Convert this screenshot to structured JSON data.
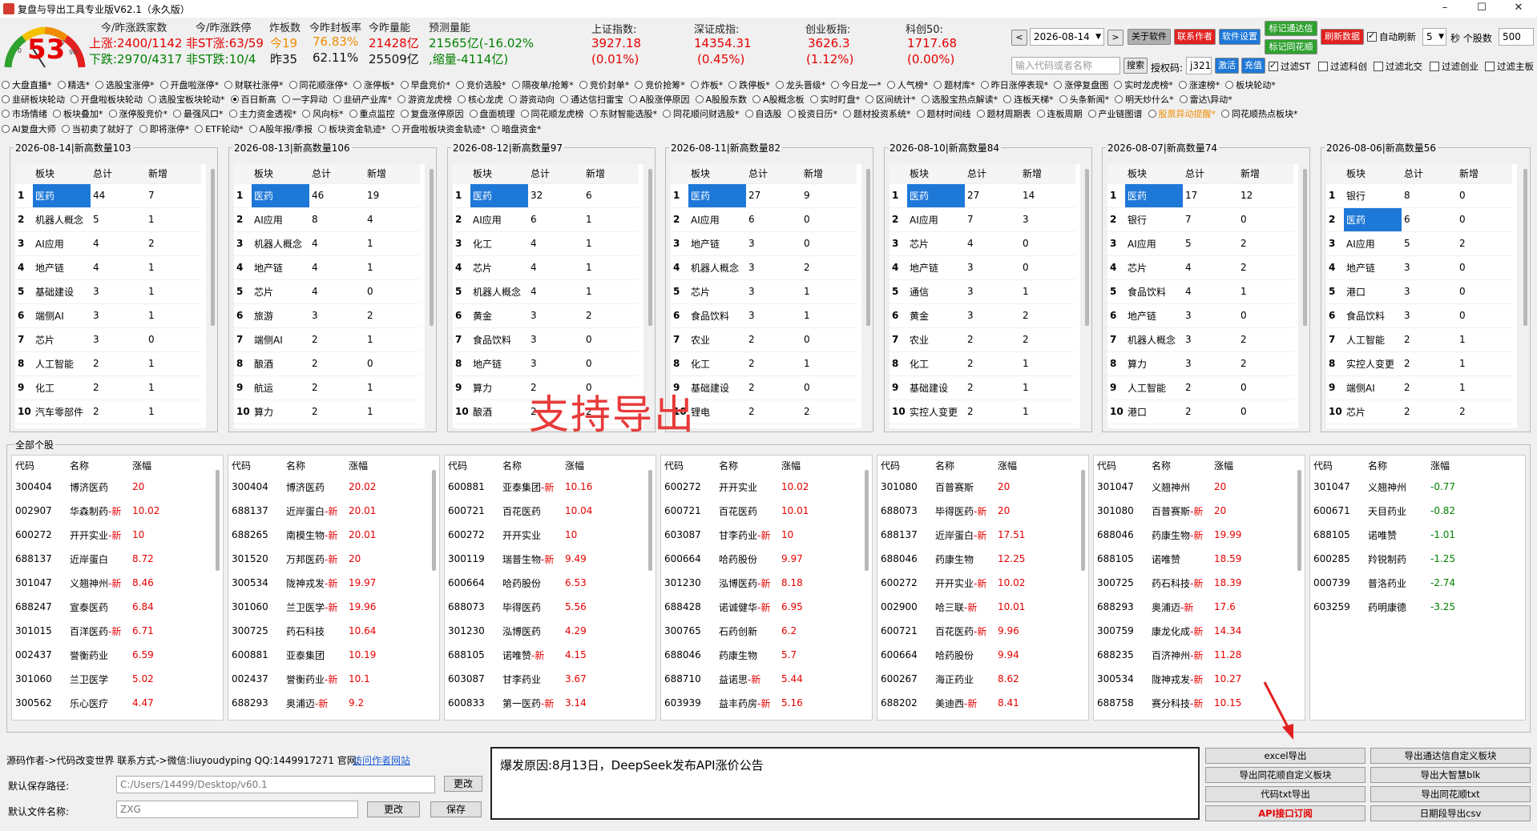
{
  "window": {
    "title": "复盘与导出工具专业版V62.1（永久版）",
    "min": "–",
    "max": "☐",
    "close": "✕"
  },
  "gauge": {
    "value": "53",
    "tick_low": "0",
    "tick_high": "90",
    "tick_mid": "70"
  },
  "header": {
    "col1_title": "今/昨涨跌家数",
    "up_line": "上涨:2400/1142",
    "down_line": "下跌:2970/4317",
    "col2_title": "今/昨涨跌停",
    "limit_up": "非ST涨:63/59",
    "limit_down": "非ST跌:10/4",
    "col3_title": "炸板数",
    "broken_today": "今19",
    "broken_yday": "昨35",
    "col4_title": "今昨封板率",
    "seal_today": "76.83%",
    "seal_yday": "62.11%",
    "col5_title": "今昨量能",
    "vol_today": "21428亿",
    "vol_yday": "25509亿",
    "col6_title": "预测量能",
    "pred_vol": "21565亿(-16.02%",
    "pred_shrink": ",缩量-4114亿)"
  },
  "indices": [
    {
      "name": "上证指数:",
      "value": "3927.18",
      "pct": "(0.01%)"
    },
    {
      "name": "深证成指:",
      "value": "14354.31",
      "pct": "(0.45%)"
    },
    {
      "name": "创业板指:",
      "value": "3626.3",
      "pct": "(1.12%)"
    },
    {
      "name": "科创50:",
      "value": "1717.68",
      "pct": "(0.00%)"
    }
  ],
  "controls": {
    "prev": "<",
    "date": "2026-08-14",
    "next": ">",
    "about": "关于软件",
    "contact": "联系作者",
    "settings": "软件设置",
    "mark_tdx": "标记通达信",
    "mark_ths": "标记同花顺",
    "refresh_data": "刷新数据",
    "auto_refresh": "自动刷新",
    "refresh_interval": "5",
    "sec_label": "秒 个股数",
    "stock_count": "500",
    "search_placeholder": "输入代码或者名称",
    "search": "搜索",
    "auth_label": "授权码:",
    "auth_code": "j321",
    "activate": "激活",
    "recharge": "充值",
    "filter_st": "过滤ST",
    "filter_kc": "过滤科创",
    "filter_bj": "过滤北交",
    "filter_cy": "过滤创业",
    "filter_main": "过滤主板"
  },
  "radio_rows": [
    [
      "大盘直播*",
      "精选*",
      "选股宝涨停*",
      "开盘啦涨停*",
      "财联社涨停*",
      "同花顺涨停*",
      "涨停板*",
      "早盘竞价*",
      "竞价选股*",
      "隔夜单/抢筹*",
      "竞价封单*",
      "竞价抢筹*",
      "炸板*",
      "跌停板*",
      "龙头晋级*",
      "今日龙一*",
      "人气榜*",
      "题材库*",
      "昨日涨停表现*",
      "涨停复盘图",
      "实时龙虎榜*",
      "涨速榜*",
      "板块轮动*"
    ],
    [
      "韭研板块轮动",
      "开盘啦板块轮动",
      "选股宝板块轮动*",
      "百日新高",
      "一字异动",
      "韭研产业库*",
      "游资龙虎榜",
      "核心龙虎",
      "游资动向",
      "通达信扫雷宝",
      "A股涨停原因",
      "A股股东数",
      "A股概念板",
      "实时盯盘*",
      "区间统计*",
      "选股宝热点解读*",
      "连板天梯*",
      "头条新闻*",
      "明天炒什么*",
      "雷达\\异动*"
    ],
    [
      "市场情绪",
      "板块叠加*",
      "涨停股竞价*",
      "最强风口*",
      "主力资金透视*",
      "风向标*",
      "重点监控",
      "复盘涨停原因",
      "盘面梳理",
      "同花顺龙虎榜",
      "东财智能选股*",
      "同花顺问财选股*",
      "自选股",
      "投资日历*",
      "题材投资系统*",
      "题材时间线",
      "题材周期表",
      "连板周期",
      "产业链图谱",
      "股票异动提醒*",
      "同花顺热点板块*"
    ],
    [
      "AI复盘大师",
      "当初卖了就好了",
      "即将涨停*",
      "ETF轮动*",
      "A股年报/季报",
      "板块资金轨迹*",
      "开盘啦板块资金轨迹*",
      "暗盘资金*"
    ]
  ],
  "radio_selected": "百日新高",
  "radio_highlight": "股票异动提醒*",
  "sector_header": {
    "idx": "",
    "name": "板块",
    "total": "总计",
    "new": "新增"
  },
  "sectors": [
    {
      "date": "2026-08-14|新高数量103",
      "rows": [
        [
          "1",
          "医药",
          "44",
          "7"
        ],
        [
          "2",
          "机器人概念",
          "5",
          "1"
        ],
        [
          "3",
          "AI应用",
          "4",
          "2"
        ],
        [
          "4",
          "地产链",
          "4",
          "1"
        ],
        [
          "5",
          "基础建设",
          "3",
          "1"
        ],
        [
          "6",
          "端侧AI",
          "3",
          "1"
        ],
        [
          "7",
          "芯片",
          "3",
          "0"
        ],
        [
          "8",
          "人工智能",
          "2",
          "1"
        ],
        [
          "9",
          "化工",
          "2",
          "1"
        ],
        [
          "10",
          "汽车零部件",
          "2",
          "1"
        ]
      ]
    },
    {
      "date": "2026-08-13|新高数量106",
      "rows": [
        [
          "1",
          "医药",
          "46",
          "19"
        ],
        [
          "2",
          "AI应用",
          "8",
          "4"
        ],
        [
          "3",
          "机器人概念",
          "4",
          "1"
        ],
        [
          "4",
          "地产链",
          "4",
          "1"
        ],
        [
          "5",
          "芯片",
          "4",
          "0"
        ],
        [
          "6",
          "旅游",
          "3",
          "2"
        ],
        [
          "7",
          "端侧AI",
          "2",
          "1"
        ],
        [
          "8",
          "酿酒",
          "2",
          "0"
        ],
        [
          "9",
          "航运",
          "2",
          "1"
        ],
        [
          "10",
          "算力",
          "2",
          "1"
        ]
      ]
    },
    {
      "date": "2026-08-12|新高数量97",
      "rows": [
        [
          "1",
          "医药",
          "32",
          "6"
        ],
        [
          "2",
          "AI应用",
          "6",
          "1"
        ],
        [
          "3",
          "化工",
          "4",
          "1"
        ],
        [
          "4",
          "芯片",
          "4",
          "1"
        ],
        [
          "5",
          "机器人概念",
          "4",
          "1"
        ],
        [
          "6",
          "黄金",
          "3",
          "2"
        ],
        [
          "7",
          "食品饮料",
          "3",
          "0"
        ],
        [
          "8",
          "地产链",
          "3",
          "0"
        ],
        [
          "9",
          "算力",
          "2",
          "0"
        ],
        [
          "10",
          "酿酒",
          "2",
          "2"
        ]
      ]
    },
    {
      "date": "2026-08-11|新高数量82",
      "rows": [
        [
          "1",
          "医药",
          "27",
          "9"
        ],
        [
          "2",
          "AI应用",
          "6",
          "0"
        ],
        [
          "3",
          "地产链",
          "3",
          "0"
        ],
        [
          "4",
          "机器人概念",
          "3",
          "2"
        ],
        [
          "5",
          "芯片",
          "3",
          "1"
        ],
        [
          "6",
          "食品饮料",
          "3",
          "1"
        ],
        [
          "7",
          "农业",
          "2",
          "0"
        ],
        [
          "8",
          "化工",
          "2",
          "1"
        ],
        [
          "9",
          "基础建设",
          "2",
          "0"
        ],
        [
          "10",
          "锂电",
          "2",
          "2"
        ]
      ]
    },
    {
      "date": "2026-08-10|新高数量84",
      "rows": [
        [
          "1",
          "医药",
          "27",
          "14"
        ],
        [
          "2",
          "AI应用",
          "7",
          "3"
        ],
        [
          "3",
          "芯片",
          "4",
          "0"
        ],
        [
          "4",
          "地产链",
          "3",
          "0"
        ],
        [
          "5",
          "通信",
          "3",
          "1"
        ],
        [
          "6",
          "黄金",
          "3",
          "2"
        ],
        [
          "7",
          "农业",
          "2",
          "2"
        ],
        [
          "8",
          "化工",
          "2",
          "1"
        ],
        [
          "9",
          "基础建设",
          "2",
          "1"
        ],
        [
          "10",
          "实控人变更",
          "2",
          "1"
        ]
      ]
    },
    {
      "date": "2026-08-07|新高数量74",
      "rows": [
        [
          "1",
          "医药",
          "17",
          "12"
        ],
        [
          "2",
          "银行",
          "7",
          "0"
        ],
        [
          "3",
          "AI应用",
          "5",
          "2"
        ],
        [
          "4",
          "芯片",
          "4",
          "2"
        ],
        [
          "5",
          "食品饮料",
          "4",
          "1"
        ],
        [
          "6",
          "地产链",
          "3",
          "0"
        ],
        [
          "7",
          "机器人概念",
          "3",
          "2"
        ],
        [
          "8",
          "算力",
          "3",
          "2"
        ],
        [
          "9",
          "人工智能",
          "2",
          "0"
        ],
        [
          "10",
          "港口",
          "2",
          "0"
        ]
      ]
    },
    {
      "date": "2026-08-06|新高数量56",
      "rows": [
        [
          "1",
          "银行",
          "8",
          "0"
        ],
        [
          "2",
          "医药",
          "6",
          "0"
        ],
        [
          "3",
          "AI应用",
          "5",
          "2"
        ],
        [
          "4",
          "地产链",
          "3",
          "0"
        ],
        [
          "5",
          "港口",
          "3",
          "0"
        ],
        [
          "6",
          "食品饮料",
          "3",
          "0"
        ],
        [
          "7",
          "人工智能",
          "2",
          "1"
        ],
        [
          "8",
          "实控人变更",
          "2",
          "1"
        ],
        [
          "9",
          "端侧AI",
          "2",
          "1"
        ],
        [
          "10",
          "芯片",
          "2",
          "2"
        ]
      ]
    }
  ],
  "sector_selected_rows": [
    1,
    1,
    1,
    1,
    1,
    1,
    2
  ],
  "stocks_title": "全部个股",
  "stock_header": {
    "code": "代码",
    "name": "名称",
    "chg": "涨幅"
  },
  "stocks": [
    [
      [
        "300404",
        "博济医药",
        "20"
      ],
      [
        "002907",
        "华森制药-新",
        "10.02"
      ],
      [
        "600272",
        "开开实业-新",
        "10"
      ],
      [
        "688137",
        "近岸蛋白",
        "8.72"
      ],
      [
        "301047",
        "义翘神州-新",
        "8.46"
      ],
      [
        "688247",
        "宣泰医药",
        "6.84"
      ],
      [
        "301015",
        "百洋医药-新",
        "6.71"
      ],
      [
        "002437",
        "誉衡药业",
        "6.59"
      ],
      [
        "301060",
        "兰卫医学",
        "5.02"
      ],
      [
        "300562",
        "乐心医疗",
        "4.47"
      ]
    ],
    [
      [
        "300404",
        "博济医药",
        "20.02"
      ],
      [
        "688137",
        "近岸蛋白-新",
        "20.01"
      ],
      [
        "688265",
        "南模生物-新",
        "20.01"
      ],
      [
        "301520",
        "万邦医药-新",
        "20"
      ],
      [
        "300534",
        "陇神戎发-新",
        "19.97"
      ],
      [
        "301060",
        "兰卫医学-新",
        "19.96"
      ],
      [
        "300725",
        "药石科技",
        "10.64"
      ],
      [
        "600881",
        "亚泰集团",
        "10.19"
      ],
      [
        "002437",
        "誉衡药业-新",
        "10.1"
      ],
      [
        "688293",
        "奥浦迈-新",
        "9.2"
      ]
    ],
    [
      [
        "600881",
        "亚泰集团-新",
        "10.16"
      ],
      [
        "600721",
        "百花医药",
        "10.04"
      ],
      [
        "600272",
        "开开实业",
        "10"
      ],
      [
        "300119",
        "瑞普生物-新",
        "9.49"
      ],
      [
        "600664",
        "哈药股份",
        "6.53"
      ],
      [
        "688073",
        "毕得医药",
        "5.56"
      ],
      [
        "301230",
        "泓博医药",
        "4.29"
      ],
      [
        "688105",
        "诺唯赞-新",
        "4.15"
      ],
      [
        "603087",
        "甘李药业",
        "3.67"
      ],
      [
        "600833",
        "第一医药-新",
        "3.14"
      ]
    ],
    [
      [
        "600272",
        "开开实业",
        "10.02"
      ],
      [
        "600721",
        "百花医药",
        "10.01"
      ],
      [
        "603087",
        "甘李药业-新",
        "10"
      ],
      [
        "600664",
        "哈药股份",
        "9.97"
      ],
      [
        "301230",
        "泓博医药-新",
        "8.18"
      ],
      [
        "688428",
        "诺诚健华-新",
        "6.95"
      ],
      [
        "300765",
        "石药创新",
        "6.2"
      ],
      [
        "688046",
        "药康生物",
        "5.7"
      ],
      [
        "688710",
        "益诺思-新",
        "5.44"
      ],
      [
        "603939",
        "益丰药房-新",
        "5.16"
      ]
    ],
    [
      [
        "301080",
        "百普赛斯",
        "20"
      ],
      [
        "688073",
        "毕得医药-新",
        "20"
      ],
      [
        "688137",
        "近岸蛋白-新",
        "17.51"
      ],
      [
        "688046",
        "药康生物",
        "12.25"
      ],
      [
        "600272",
        "开开实业-新",
        "10.02"
      ],
      [
        "002900",
        "哈三联-新",
        "10.01"
      ],
      [
        "600721",
        "百花医药-新",
        "9.96"
      ],
      [
        "600664",
        "哈药股份",
        "9.94"
      ],
      [
        "600267",
        "海正药业",
        "8.62"
      ],
      [
        "688202",
        "美迪西-新",
        "8.41"
      ]
    ],
    [
      [
        "301047",
        "义翘神州",
        "20"
      ],
      [
        "301080",
        "百普赛斯-新",
        "20"
      ],
      [
        "688046",
        "药康生物-新",
        "19.99"
      ],
      [
        "688105",
        "诺唯赞",
        "18.59"
      ],
      [
        "300725",
        "药石科技-新",
        "18.39"
      ],
      [
        "688293",
        "奥浦迈-新",
        "17.6"
      ],
      [
        "300759",
        "康龙化成-新",
        "14.34"
      ],
      [
        "688235",
        "百济神州-新",
        "11.28"
      ],
      [
        "300534",
        "陇神戎发-新",
        "10.27"
      ],
      [
        "688758",
        "赛分科技-新",
        "10.15"
      ]
    ],
    [
      [
        "301047",
        "义翘神州",
        "-0.77"
      ],
      [
        "600671",
        "天目药业",
        "-0.82"
      ],
      [
        "688105",
        "诺唯赞",
        "-1.01"
      ],
      [
        "600285",
        "羚锐制药",
        "-1.25"
      ],
      [
        "000739",
        "普洛药业",
        "-2.74"
      ],
      [
        "603259",
        "药明康德",
        "-3.25"
      ]
    ]
  ],
  "overlay_text": "支持导出",
  "footer": {
    "author": "源码作者->代码改变世界 联系方式->微信:liuyoudyping QQ:1449917271 官网:",
    "site_link": "访问作者网站",
    "save_path_label": "默认保存路径:",
    "save_path": "C:/Users/14499/Desktop/v60.1",
    "change1": "更改",
    "filename_label": "默认文件名称:",
    "filename": "ZXG",
    "change2": "更改",
    "save": "保存"
  },
  "reason": "爆发原因:8月13日，DeepSeek发布API涨价公告",
  "export_buttons": [
    [
      "excel导出",
      "导出通达信自定义板块"
    ],
    [
      "导出同花顺自定义板块",
      "导出大智慧blk"
    ],
    [
      "代码txt导出",
      "导出同花顺txt"
    ],
    [
      "API接口订阅",
      "日期段导出csv"
    ]
  ],
  "colors": {
    "red": "#e60000",
    "green": "#008000",
    "select_blue": "#1e78d8",
    "orange": "#f08c00"
  }
}
